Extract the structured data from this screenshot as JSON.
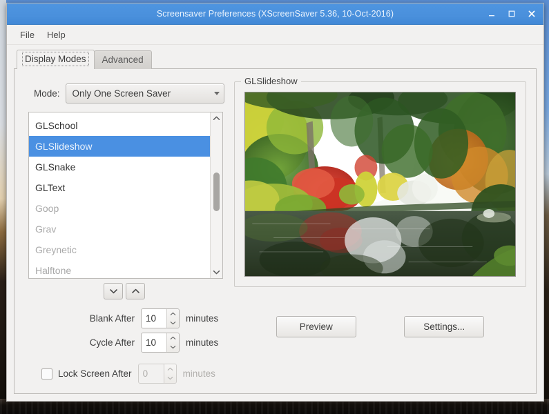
{
  "window": {
    "title": "Screensaver Preferences  (XScreenSaver 5.36, 10-Oct-2016)",
    "controls": {
      "minimize": "minimize-icon",
      "maximize": "maximize-icon",
      "close": "close-icon"
    }
  },
  "menubar": {
    "items": [
      {
        "label": "File"
      },
      {
        "label": "Help"
      }
    ]
  },
  "tabs": [
    {
      "label": "Display Modes",
      "active": true
    },
    {
      "label": "Advanced",
      "active": false
    }
  ],
  "mode": {
    "label": "Mode:",
    "selected": "Only One Screen Saver",
    "options": [
      "Only One Screen Saver"
    ]
  },
  "saver_list": {
    "items": [
      {
        "label": "GLSchool",
        "selected": false,
        "disabled": false
      },
      {
        "label": "GLSlideshow",
        "selected": true,
        "disabled": false
      },
      {
        "label": "GLSnake",
        "selected": false,
        "disabled": false
      },
      {
        "label": "GLText",
        "selected": false,
        "disabled": false
      },
      {
        "label": "Goop",
        "selected": false,
        "disabled": true
      },
      {
        "label": "Grav",
        "selected": false,
        "disabled": true
      },
      {
        "label": "Greynetic",
        "selected": false,
        "disabled": true
      },
      {
        "label": "Halftone",
        "selected": false,
        "disabled": true
      }
    ],
    "scroll_up_icon": "chevron-up-icon",
    "scroll_down_icon": "chevron-down-icon"
  },
  "reorder": {
    "down_icon": "chevron-down-icon",
    "up_icon": "chevron-up-icon"
  },
  "timers": {
    "blank": {
      "label": "Blank After",
      "value": "10",
      "unit": "minutes",
      "disabled": false
    },
    "cycle": {
      "label": "Cycle After",
      "value": "10",
      "unit": "minutes",
      "disabled": false
    },
    "lock": {
      "label": "Lock Screen After",
      "value": "0",
      "unit": "minutes",
      "checked": false,
      "disabled": true
    }
  },
  "preview": {
    "legend": "GLSlideshow",
    "image_description": "garden-pond-photo"
  },
  "actions": {
    "preview": "Preview",
    "settings": "Settings..."
  },
  "colors": {
    "titlebar": "#4a90dc",
    "selection": "#4a90e2",
    "window_bg": "#f2f1f0",
    "border": "#bdbbb8",
    "text": "#3f3f3f",
    "disabled_text": "#a9a9a9"
  }
}
